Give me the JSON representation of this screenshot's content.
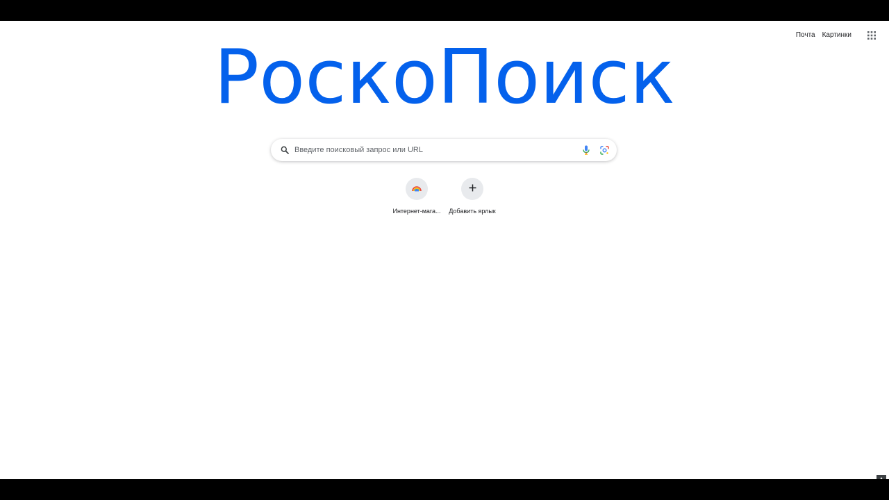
{
  "header": {
    "links": [
      {
        "label": "Почта"
      },
      {
        "label": "Картинки"
      }
    ],
    "apps_icon": "apps-grid-icon"
  },
  "logo": {
    "text": "РоскоПоиск",
    "color": "#0461ec"
  },
  "search": {
    "placeholder": "Введите поисковый запрос или URL",
    "value": "",
    "icons": [
      "search-icon",
      "microphone-icon",
      "lens-icon"
    ]
  },
  "shortcuts": [
    {
      "label": "Интернет-мага...",
      "icon": "rainbow-icon"
    },
    {
      "label": "Добавить ярлык",
      "icon": "plus-icon"
    }
  ]
}
